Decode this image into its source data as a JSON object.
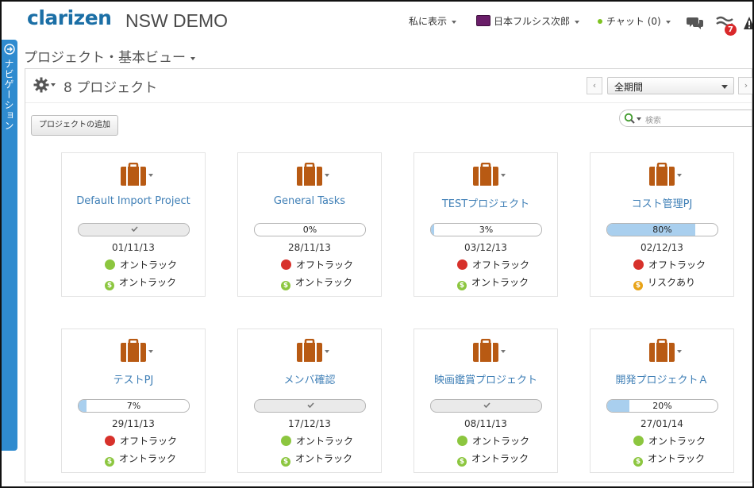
{
  "header": {
    "logo": "clarizen",
    "workspace": "NSW DEMO",
    "show_menu": "私に表示",
    "user_name": "日本フルシス次郎",
    "chat_label": "チャット (0)",
    "notification_count": "7"
  },
  "nav": {
    "label": "ナビゲーション"
  },
  "view": {
    "title": "プロジェクト・基本ビュー",
    "count_label": "8 プロジェクト",
    "period": "全期間",
    "add_button": "プロジェクトの追加",
    "search_placeholder": "検索"
  },
  "colors": {
    "green": "#8cc63f",
    "red": "#d7312b",
    "orange": "#e8a317",
    "briefcase": "#b85a13",
    "link": "#3f7fb6",
    "nav": "#2f8bcf"
  },
  "projects": [
    {
      "name": "Default Import Project",
      "progress": 100,
      "progress_label": "",
      "complete": true,
      "date": "01/11/13",
      "status1": {
        "label": "オントラック",
        "color": "green"
      },
      "status2": {
        "label": "オントラック",
        "color": "green"
      }
    },
    {
      "name": "General Tasks",
      "progress": 0,
      "progress_label": "0%",
      "complete": false,
      "date": "28/11/13",
      "status1": {
        "label": "オフトラック",
        "color": "red"
      },
      "status2": {
        "label": "オントラック",
        "color": "green"
      }
    },
    {
      "name": "TESTプロジェクト",
      "progress": 3,
      "progress_label": "3%",
      "complete": false,
      "date": "03/12/13",
      "status1": {
        "label": "オフトラック",
        "color": "red"
      },
      "status2": {
        "label": "オントラック",
        "color": "green"
      }
    },
    {
      "name": "コスト管理PJ",
      "progress": 80,
      "progress_label": "80%",
      "complete": false,
      "date": "02/12/13",
      "status1": {
        "label": "オフトラック",
        "color": "red"
      },
      "status2": {
        "label": "リスクあり",
        "color": "orange"
      }
    },
    {
      "name": "テストPJ",
      "progress": 7,
      "progress_label": "7%",
      "complete": false,
      "date": "29/11/13",
      "status1": {
        "label": "オフトラック",
        "color": "red"
      },
      "status2": {
        "label": "オントラック",
        "color": "green"
      }
    },
    {
      "name": "メンバ確認",
      "progress": 100,
      "progress_label": "",
      "complete": true,
      "date": "17/12/13",
      "status1": {
        "label": "オントラック",
        "color": "green"
      },
      "status2": {
        "label": "オントラック",
        "color": "green"
      }
    },
    {
      "name": "映画鑑賞プロジェクト",
      "progress": 100,
      "progress_label": "",
      "complete": true,
      "date": "08/11/13",
      "status1": {
        "label": "オントラック",
        "color": "green"
      },
      "status2": {
        "label": "オントラック",
        "color": "green"
      }
    },
    {
      "name": "開発プロジェクトＡ",
      "progress": 20,
      "progress_label": "20%",
      "complete": false,
      "date": "27/01/14",
      "status1": {
        "label": "オントラック",
        "color": "green"
      },
      "status2": {
        "label": "オントラック",
        "color": "green"
      }
    }
  ]
}
